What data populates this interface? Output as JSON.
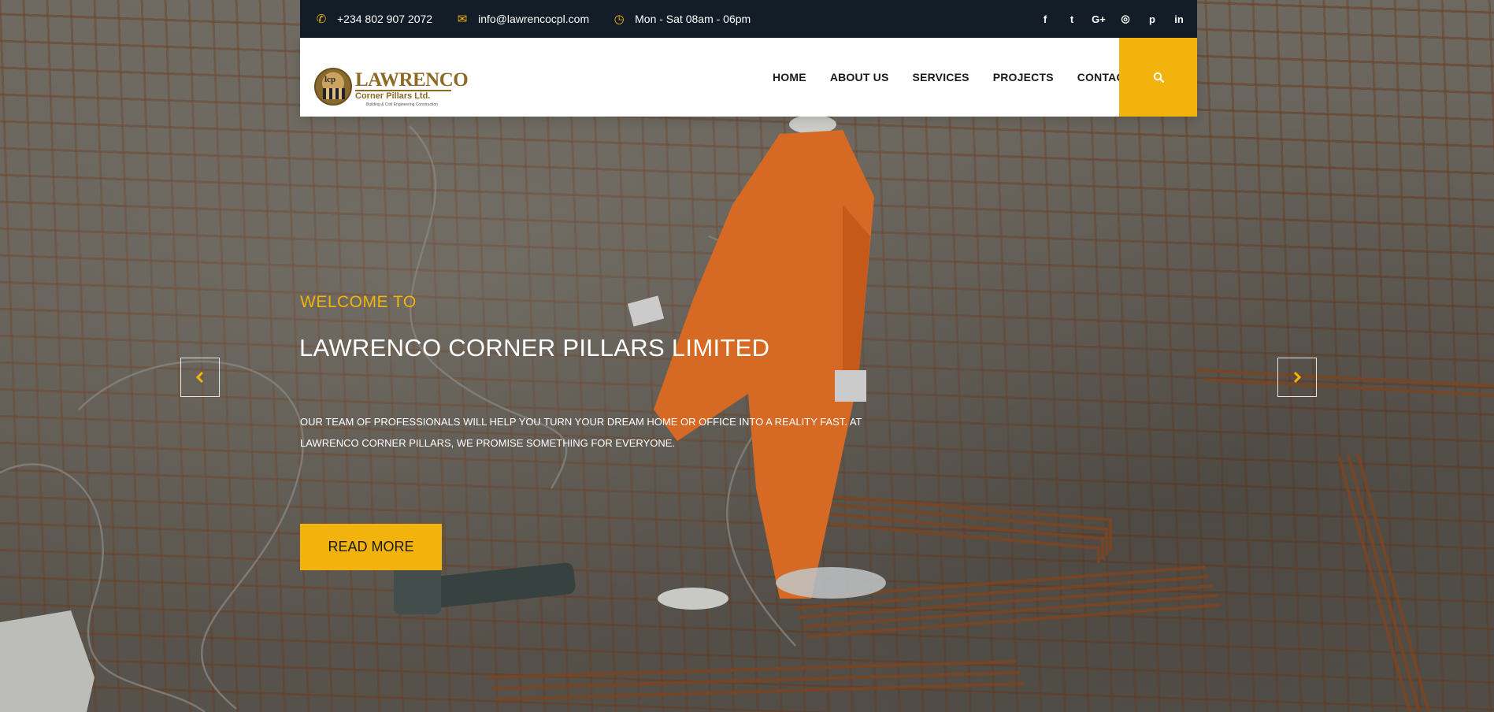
{
  "topbar": {
    "phone": "+234 802 907 2072",
    "email": "info@lawrencocpl.com",
    "hours": "Mon - Sat 08am - 06pm",
    "icons": {
      "phone": "phone-icon",
      "email": "envelope-icon",
      "hours": "clock-icon"
    },
    "social": [
      {
        "name": "facebook-icon",
        "glyph": "f"
      },
      {
        "name": "twitter-icon",
        "glyph": "t"
      },
      {
        "name": "google-plus-icon",
        "glyph": "G+"
      },
      {
        "name": "instagram-icon",
        "glyph": "◎"
      },
      {
        "name": "pinterest-icon",
        "glyph": "p"
      },
      {
        "name": "linkedin-icon",
        "glyph": "in"
      }
    ]
  },
  "logo": {
    "emblem": "lcp",
    "name": "LAWRENCO",
    "sub": "Corner Pillars Ltd.",
    "tagline": "Building & Civil Engineering Construction"
  },
  "nav": {
    "items": [
      "HOME",
      "ABOUT US",
      "SERVICES",
      "PROJECTS",
      "CONTACT"
    ],
    "search_icon": "search-icon"
  },
  "slide": {
    "welcome": "WELCOME TO",
    "headline": "LAWRENCO CORNER PILLARS LIMITED",
    "description": "OUR TEAM OF PROFESSIONALS WILL HELP YOU TURN YOUR DREAM HOME OR OFFICE INTO A REALITY FAST. AT LAWRENCO CORNER PILLARS, WE PROMISE SOMETHING FOR EVERYONE.",
    "button": "READ MORE",
    "prev_icon": "chevron-left-icon",
    "next_icon": "chevron-right-icon"
  },
  "colors": {
    "accent": "#f2b40c",
    "topbar_bg": "#121d27",
    "header_bg": "#ffffff",
    "brand_gold": "#8d6a25"
  }
}
